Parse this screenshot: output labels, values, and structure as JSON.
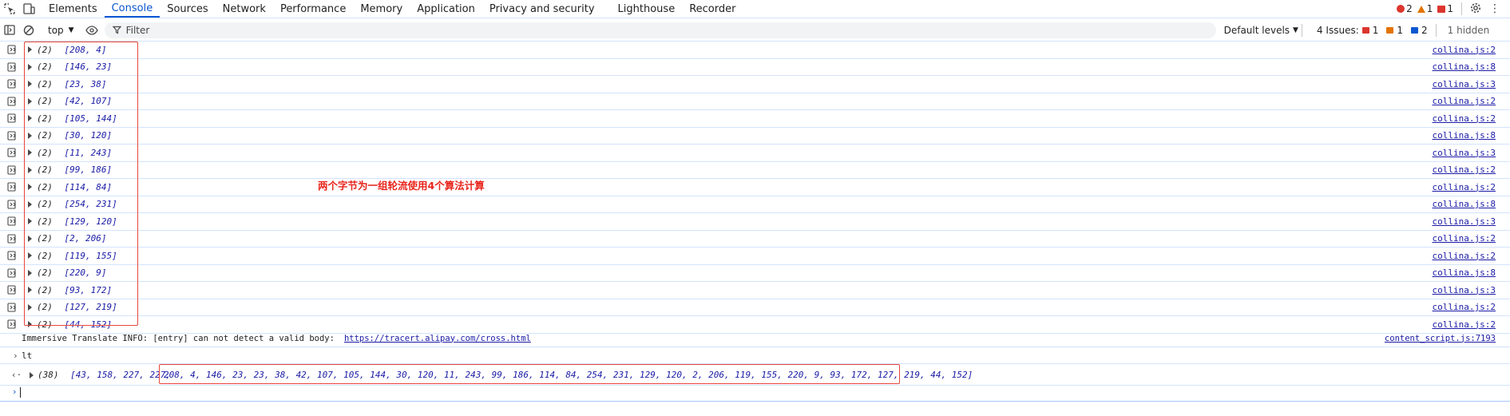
{
  "tabs": [
    "Elements",
    "Console",
    "Sources",
    "Network",
    "Performance",
    "Memory",
    "Application",
    "Privacy and security",
    "Lighthouse",
    "Recorder"
  ],
  "active_tab": "Console",
  "counts": {
    "errors": "2",
    "warnings": "1",
    "issues": "1"
  },
  "toolbar": {
    "context": "top",
    "filter_placeholder": "Filter",
    "levels": "Default levels",
    "issues_label": "4 Issues:",
    "issues_red": "1",
    "issues_orange": "1",
    "issues_blue": "2",
    "hidden": "1 hidden"
  },
  "rows": [
    {
      "len": "(2)",
      "value": "[208, 4]",
      "src": "collina.js:2"
    },
    {
      "len": "(2)",
      "value": "[146, 23]",
      "src": "collina.js:8"
    },
    {
      "len": "(2)",
      "value": "[23, 38]",
      "src": "collina.js:3"
    },
    {
      "len": "(2)",
      "value": "[42, 107]",
      "src": "collina.js:2"
    },
    {
      "len": "(2)",
      "value": "[105, 144]",
      "src": "collina.js:2"
    },
    {
      "len": "(2)",
      "value": "[30, 120]",
      "src": "collina.js:8"
    },
    {
      "len": "(2)",
      "value": "[11, 243]",
      "src": "collina.js:3"
    },
    {
      "len": "(2)",
      "value": "[99, 186]",
      "src": "collina.js:2"
    },
    {
      "len": "(2)",
      "value": "[114, 84]",
      "src": "collina.js:2"
    },
    {
      "len": "(2)",
      "value": "[254, 231]",
      "src": "collina.js:8"
    },
    {
      "len": "(2)",
      "value": "[129, 120]",
      "src": "collina.js:3"
    },
    {
      "len": "(2)",
      "value": "[2, 206]",
      "src": "collina.js:2"
    },
    {
      "len": "(2)",
      "value": "[119, 155]",
      "src": "collina.js:2"
    },
    {
      "len": "(2)",
      "value": "[220, 9]",
      "src": "collina.js:8"
    },
    {
      "len": "(2)",
      "value": "[93, 172]",
      "src": "collina.js:3"
    },
    {
      "len": "(2)",
      "value": "[127, 219]",
      "src": "collina.js:2"
    },
    {
      "len": "(2)",
      "value": "[44, 152]",
      "src": "collina.js:2"
    }
  ],
  "annotation": "两个字节为一组轮流使用4个算法计算",
  "info": {
    "text": "Immersive Translate INFO: [entry] can not detect a valid body:",
    "link": "https://tracert.alipay.com/cross.html",
    "src": "content_script.js:7193"
  },
  "input_echo": "lt",
  "result": {
    "len": "(38)",
    "head": "[43, 158, 227, 227,",
    "rest": "208, 4, 146, 23, 23, 38, 42, 107, 105, 144, 30, 120, 11, 243, 99, 186, 114, 84, 254, 231, 129, 120, 2, 206, 119, 155, 220, 9, 93, 172, 127, 219, 44, 152]"
  },
  "colors": {
    "accent": "#0b57d0",
    "error": "#dc362e",
    "warning": "#e37400",
    "annotation": "#e8251c"
  }
}
